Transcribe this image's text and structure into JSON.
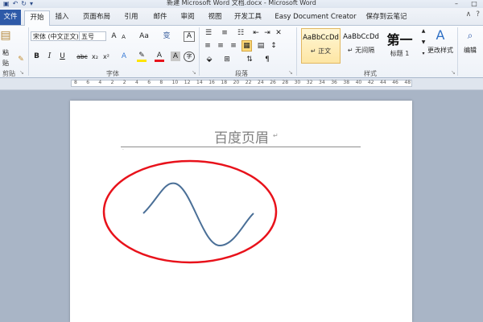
{
  "window": {
    "title": "新建 Microsoft Word 文档.docx - Microsoft Word",
    "quick_access": [
      "save-icon",
      "undo-icon",
      "redo-icon",
      "customize-icon"
    ]
  },
  "tabs": [
    "文件",
    "开始",
    "插入",
    "页面布局",
    "引用",
    "邮件",
    "审阅",
    "视图",
    "开发工具",
    "Easy Document Creator",
    "保存到云笔记"
  ],
  "active_tab": "开始",
  "ribbon": {
    "clipboard": {
      "paste_label": "粘贴",
      "group_label": "剪贴板"
    },
    "font": {
      "font_name": "宋体 (中文正文)",
      "font_size": "五号",
      "grow": "A",
      "shrink": "A",
      "aa": "Aa",
      "wen": "变",
      "a_box": "A",
      "bold": "B",
      "italic": "I",
      "underline": "U",
      "strike": "abc",
      "sub": "x₂",
      "sup": "x²",
      "highlight": "A",
      "color": "A",
      "charfmt": "A",
      "encircle": "字",
      "group_label": "字体"
    },
    "paragraph": {
      "group_label": "段落"
    },
    "styles": {
      "items": [
        {
          "preview": "AaBbCcDd",
          "name": "↵ 正文",
          "selected": true
        },
        {
          "preview": "AaBbCcDd",
          "name": "↵ 无间隔",
          "selected": false
        },
        {
          "preview": "第一",
          "name": "标题 1",
          "selected": false
        }
      ],
      "change_styles": "更改样式",
      "group_label": "样式"
    },
    "editing": {
      "label": "编辑"
    }
  },
  "ruler": {
    "ticks": [
      "8",
      "6",
      "4",
      "2",
      "2",
      "4",
      "6",
      "8",
      "10",
      "12",
      "14",
      "16",
      "18",
      "20",
      "22",
      "24",
      "26",
      "28",
      "30",
      "32",
      "34",
      "36",
      "38",
      "40",
      "42",
      "44",
      "46",
      "48"
    ]
  },
  "document": {
    "header_text": "百度页眉",
    "paragraph_mark": "↵",
    "colors": {
      "ellipse": "#e8121b",
      "curve": "#4a6f97",
      "file_tab": "#2e5aa8"
    }
  }
}
